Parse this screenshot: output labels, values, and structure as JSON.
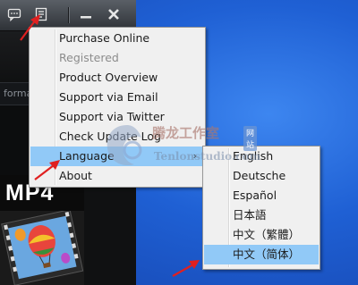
{
  "app": {
    "search_placeholder": "forma",
    "tile_label": "MP4"
  },
  "main_menu": {
    "items": [
      {
        "label": "Purchase Online",
        "enabled": true
      },
      {
        "label": "Registered",
        "enabled": false
      },
      {
        "label": "Product Overview",
        "enabled": true
      },
      {
        "label": "Support via Email",
        "enabled": true
      },
      {
        "label": "Support via Twitter",
        "enabled": true
      },
      {
        "label": "Check Update Log",
        "enabled": true
      },
      {
        "label": "Language",
        "enabled": true,
        "submenu": true,
        "highlighted": true
      },
      {
        "label": "About",
        "enabled": true
      }
    ],
    "submenu_arrow": "›"
  },
  "language_menu": {
    "items": [
      {
        "label": "English"
      },
      {
        "label": "Deutsche"
      },
      {
        "label": "Español"
      },
      {
        "label": "日本語"
      },
      {
        "label": "中文（繁體）"
      },
      {
        "label": "中文（简体）",
        "highlighted": true
      }
    ]
  },
  "watermark": {
    "chinese": "腾龙工作室",
    "badge": "网站",
    "english": "Tenlonstudio.com"
  },
  "colors": {
    "highlight": "#91c9f7",
    "menu_bg": "#f0f0f0",
    "annotation_arrow": "#e02020",
    "desktop": "#1f60d4"
  },
  "icons": [
    "chat-icon",
    "menu-icon",
    "minimize-icon",
    "close-icon"
  ]
}
